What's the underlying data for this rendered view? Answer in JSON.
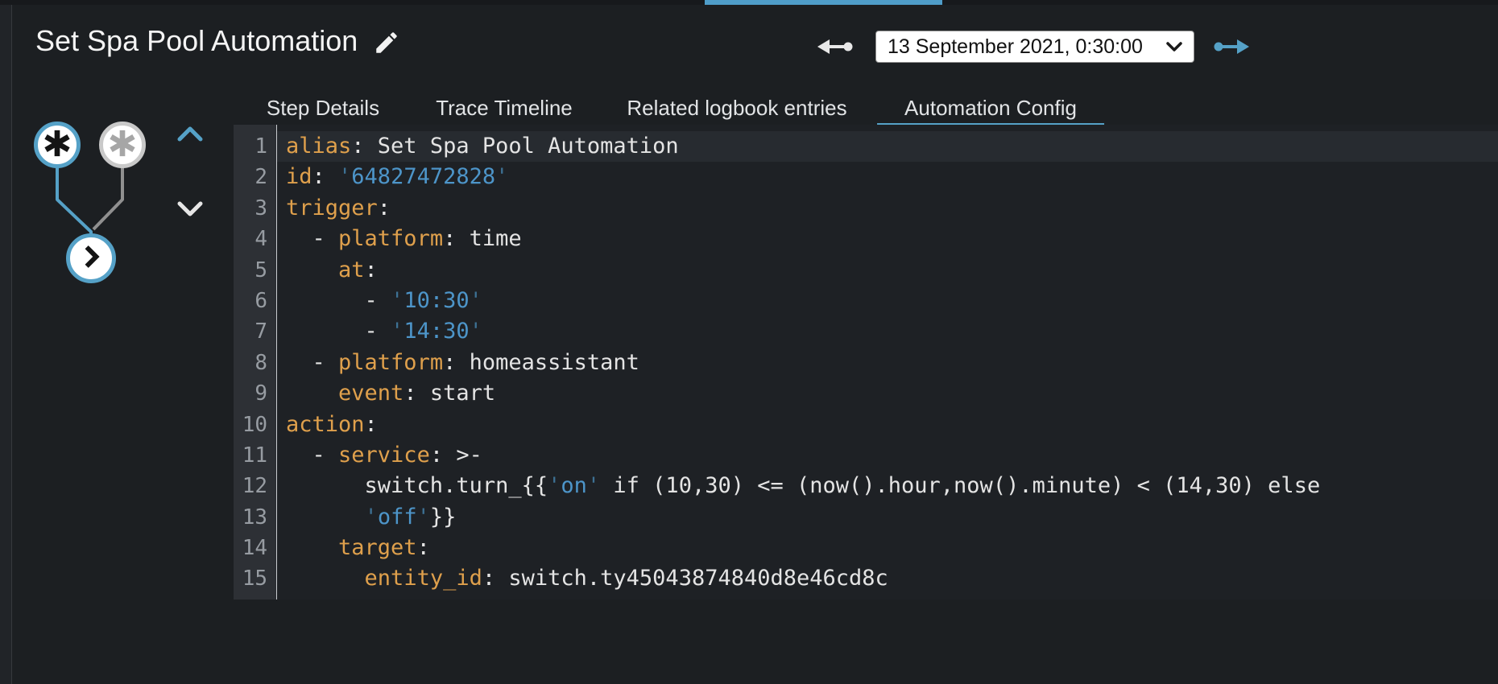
{
  "colors": {
    "accent": "#55a1c7",
    "top_indicator": "#4f9dc9",
    "page_bg": "#1c1f22",
    "editor_bg": "#1e2125",
    "gutter_bg": "#2d3035",
    "active_line_bg": "#272b30",
    "yaml_key": "#dfa04c",
    "yaml_string": "#4d95c9",
    "yaml_quote": "#3d7194",
    "node_inactive_border": "#c9c9c9"
  },
  "header": {
    "title": "Set Spa Pool Automation",
    "edit_icon": "pencil-icon"
  },
  "trace_nav": {
    "older_icon": "ray-end-arrow-icon",
    "selected": "13 September 2021, 0:30:00",
    "select_chevron_icon": "chevron-down-icon",
    "newer_icon": "ray-start-arrow-icon"
  },
  "tabs": [
    {
      "label": "Step Details",
      "active": false
    },
    {
      "label": "Trace Timeline",
      "active": false
    },
    {
      "label": "Related logbook entries",
      "active": false
    },
    {
      "label": "Automation Config",
      "active": true
    }
  ],
  "graph": {
    "nodes": [
      {
        "id": "trigger-0",
        "icon": "asterisk-icon",
        "state": "active"
      },
      {
        "id": "trigger-1",
        "icon": "asterisk-icon",
        "state": "inactive"
      },
      {
        "id": "action-0",
        "icon": "chevron-right-icon",
        "state": "active"
      }
    ],
    "controls": [
      {
        "id": "up",
        "icon": "chevron-up-icon"
      },
      {
        "id": "down",
        "icon": "chevron-down-icon"
      }
    ]
  },
  "editor": {
    "language": "yaml",
    "lines": [
      {
        "num": 1,
        "active": true,
        "segments": [
          {
            "text": "alias",
            "type": "key"
          },
          {
            "text": ": Set Spa Pool Automation",
            "type": "plain"
          }
        ]
      },
      {
        "num": 2,
        "active": false,
        "segments": [
          {
            "text": "id",
            "type": "key"
          },
          {
            "text": ": ",
            "type": "plain"
          },
          {
            "text": "'",
            "type": "quote"
          },
          {
            "text": "64827472828",
            "type": "string"
          },
          {
            "text": "'",
            "type": "quote"
          }
        ]
      },
      {
        "num": 3,
        "active": false,
        "segments": [
          {
            "text": "trigger",
            "type": "key"
          },
          {
            "text": ":",
            "type": "plain"
          }
        ]
      },
      {
        "num": 4,
        "active": false,
        "segments": [
          {
            "text": "  - ",
            "type": "plain"
          },
          {
            "text": "platform",
            "type": "key"
          },
          {
            "text": ": time",
            "type": "plain"
          }
        ]
      },
      {
        "num": 5,
        "active": false,
        "segments": [
          {
            "text": "    ",
            "type": "plain"
          },
          {
            "text": "at",
            "type": "key"
          },
          {
            "text": ":",
            "type": "plain"
          }
        ]
      },
      {
        "num": 6,
        "active": false,
        "segments": [
          {
            "text": "      - ",
            "type": "plain"
          },
          {
            "text": "'",
            "type": "quote"
          },
          {
            "text": "10:30",
            "type": "string"
          },
          {
            "text": "'",
            "type": "quote"
          }
        ]
      },
      {
        "num": 7,
        "active": false,
        "segments": [
          {
            "text": "      - ",
            "type": "plain"
          },
          {
            "text": "'",
            "type": "quote"
          },
          {
            "text": "14:30",
            "type": "string"
          },
          {
            "text": "'",
            "type": "quote"
          }
        ]
      },
      {
        "num": 8,
        "active": false,
        "segments": [
          {
            "text": "  - ",
            "type": "plain"
          },
          {
            "text": "platform",
            "type": "key"
          },
          {
            "text": ": homeassistant",
            "type": "plain"
          }
        ]
      },
      {
        "num": 9,
        "active": false,
        "segments": [
          {
            "text": "    ",
            "type": "plain"
          },
          {
            "text": "event",
            "type": "key"
          },
          {
            "text": ": start",
            "type": "plain"
          }
        ]
      },
      {
        "num": 10,
        "active": false,
        "segments": [
          {
            "text": "action",
            "type": "key"
          },
          {
            "text": ":",
            "type": "plain"
          }
        ]
      },
      {
        "num": 11,
        "active": false,
        "segments": [
          {
            "text": "  - ",
            "type": "plain"
          },
          {
            "text": "service",
            "type": "key"
          },
          {
            "text": ": >-",
            "type": "plain"
          }
        ]
      },
      {
        "num": 12,
        "active": false,
        "segments": [
          {
            "text": "      switch.turn_{{",
            "type": "plain"
          },
          {
            "text": "'",
            "type": "quote"
          },
          {
            "text": "on",
            "type": "string"
          },
          {
            "text": "'",
            "type": "quote"
          },
          {
            "text": " if (10,30) <= (now().hour,now().minute) < (14,30) else",
            "type": "plain"
          }
        ]
      },
      {
        "num": 13,
        "active": false,
        "segments": [
          {
            "text": "      ",
            "type": "plain"
          },
          {
            "text": "'",
            "type": "quote"
          },
          {
            "text": "off",
            "type": "string"
          },
          {
            "text": "'",
            "type": "quote"
          },
          {
            "text": "}}",
            "type": "plain"
          }
        ]
      },
      {
        "num": 14,
        "active": false,
        "segments": [
          {
            "text": "    ",
            "type": "plain"
          },
          {
            "text": "target",
            "type": "key"
          },
          {
            "text": ":",
            "type": "plain"
          }
        ]
      },
      {
        "num": 15,
        "active": false,
        "segments": [
          {
            "text": "      ",
            "type": "plain"
          },
          {
            "text": "entity_id",
            "type": "key"
          },
          {
            "text": ": switch.ty45043874840d8e46cd8c",
            "type": "plain"
          }
        ]
      }
    ]
  }
}
